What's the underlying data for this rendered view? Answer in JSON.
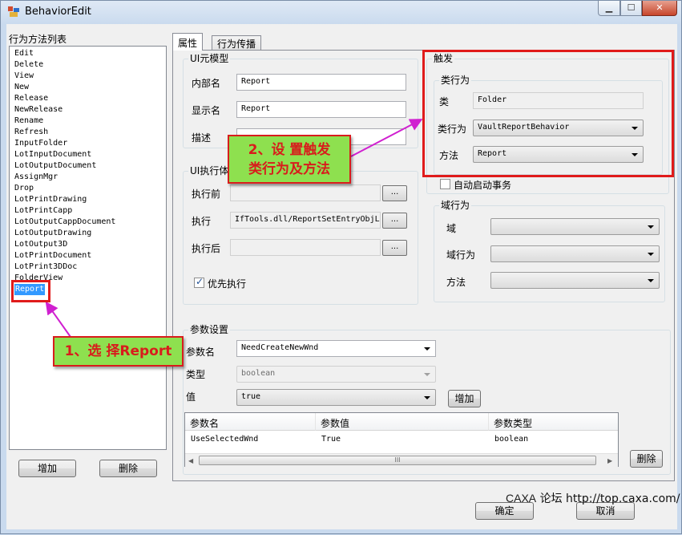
{
  "window": {
    "title": "BehaviorEdit",
    "minimize_glyph": "▁",
    "maximize_glyph": "☐",
    "close_glyph": "✕"
  },
  "left_panel": {
    "title": "行为方法列表",
    "items": [
      "Edit",
      "Delete",
      "View",
      "New",
      "Release",
      "NewRelease",
      "Rename",
      "Refresh",
      "InputFolder",
      "LotInputDocument",
      "LotOutputDocument",
      "AssignMgr",
      "Drop",
      "LotPrintDrawing",
      "LotPrintCapp",
      "LotOutputCappDocument",
      "LotOutputDrawing",
      "LotOutput3D",
      "LotPrintDocument",
      "LotPrint3DDoc",
      "FolderView",
      "Report"
    ],
    "selected_index": 21,
    "add_button": "增加",
    "delete_button": "删除"
  },
  "tabs": [
    {
      "label": "属性",
      "active": true
    },
    {
      "label": "行为传播",
      "active": false
    }
  ],
  "ui_model": {
    "title": "UI元模型",
    "internal_name_label": "内部名",
    "internal_name_value": "Report",
    "display_name_label": "显示名",
    "display_name_value": "Report",
    "description_label": "描述",
    "description_value": ""
  },
  "ui_exec": {
    "title": "UI执行体",
    "before_label": "执行前",
    "before_value": "",
    "exec_label": "执行",
    "exec_value": "IfTools.dll/ReportSetEntryObjLi",
    "after_label": "执行后",
    "after_value": "",
    "browse_glyph": "...",
    "priority_label": "优先执行",
    "priority_checked": true
  },
  "trigger": {
    "title": "触发",
    "class_behavior_title": "类行为",
    "class_label": "类",
    "class_value": "Folder",
    "behavior_label": "类行为",
    "behavior_value": "VaultReportBehavior",
    "method_label": "方法",
    "method_value": "Report",
    "auto_transaction_label": "自动启动事务",
    "auto_transaction_checked": false
  },
  "domain_behavior": {
    "title": "域行为",
    "domain_label": "域",
    "domain_value": "",
    "behavior_label": "域行为",
    "behavior_value": "",
    "method_label": "方法",
    "method_value": ""
  },
  "params": {
    "title": "参数设置",
    "name_label": "参数名",
    "name_value": "NeedCreateNewWnd",
    "type_label": "类型",
    "type_value": "boolean",
    "value_label": "值",
    "value_value": "true",
    "add_button": "增加",
    "delete_button": "删除",
    "grid": {
      "columns": [
        "参数名",
        "参数值",
        "参数类型"
      ],
      "rows": [
        [
          "UseSelectedWnd",
          "True",
          "boolean"
        ]
      ]
    },
    "scroll_left": "◀",
    "scroll_right": "▶",
    "scroll_grip": "III"
  },
  "footer": {
    "ok_button": "确定",
    "cancel_button": "取消"
  },
  "annotations": {
    "callout1": "1、选 择Report",
    "callout2_line1": "2、设 置触发",
    "callout2_line2": "类行为及方法",
    "color": "#e01b1b",
    "callout_fill": "#8ee04f",
    "arrow_color": "#d020d0"
  },
  "watermark": {
    "brand": "CAXA",
    "forum": "论坛",
    "url": "http://top.caxa.com/"
  }
}
